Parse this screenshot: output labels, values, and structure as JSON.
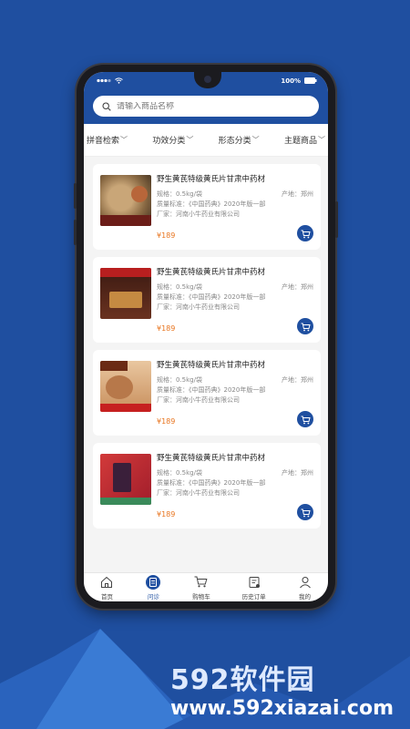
{
  "status": {
    "battery": "100%"
  },
  "search": {
    "placeholder": "请输入商品名称"
  },
  "filters": [
    {
      "label": "拼音检索"
    },
    {
      "label": "功效分类"
    },
    {
      "label": "形态分类"
    },
    {
      "label": "主题商品"
    }
  ],
  "products": [
    {
      "name": "野生黄芪特级黄氏片甘肃中药材",
      "spec": "规格：0.5kg/袋",
      "origin": "产地：郑州",
      "quality": "质量标准：《中国药典》2020年版一部",
      "maker": "厂家：河南小牛药业有限公司",
      "price": "¥189"
    },
    {
      "name": "野生黄芪特级黄氏片甘肃中药材",
      "spec": "规格：0.5kg/袋",
      "origin": "产地：郑州",
      "quality": "质量标准：《中国药典》2020年版一部",
      "maker": "厂家：河南小牛药业有限公司",
      "price": "¥189"
    },
    {
      "name": "野生黄芪特级黄氏片甘肃中药材",
      "spec": "规格：0.5kg/袋",
      "origin": "产地：郑州",
      "quality": "质量标准：《中国药典》2020年版一部",
      "maker": "厂家：河南小牛药业有限公司",
      "price": "¥189"
    },
    {
      "name": "野生黄芪特级黄氏片甘肃中药材",
      "spec": "规格：0.5kg/袋",
      "origin": "产地：郑州",
      "quality": "质量标准：《中国药典》2020年版一部",
      "maker": "厂家：河南小牛药业有限公司",
      "price": "¥189"
    }
  ],
  "tabs": [
    {
      "label": "首页",
      "icon": "home-icon"
    },
    {
      "label": "问诊",
      "icon": "consult-icon"
    },
    {
      "label": "购物车",
      "icon": "cart-icon"
    },
    {
      "label": "历史订单",
      "icon": "orders-icon"
    },
    {
      "label": "我的",
      "icon": "user-icon"
    }
  ],
  "watermark": {
    "title": "592软件园",
    "url": "www.592xiazai.com"
  },
  "colors": {
    "primary": "#1f4fa0",
    "price": "#e8741e",
    "background": "#1f4fa0"
  }
}
